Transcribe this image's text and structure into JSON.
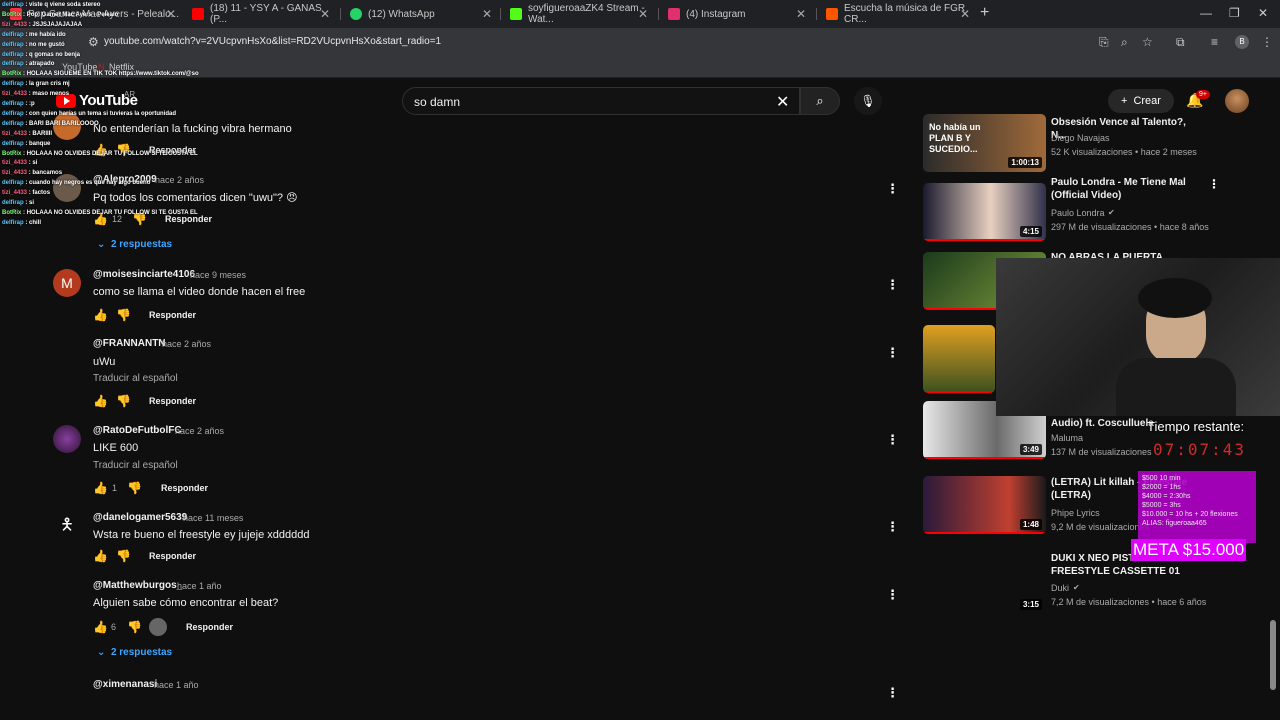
{
  "browser": {
    "tabs": [
      {
        "label": "Pop Gamer Mac Ayers - Pelealo...",
        "color": "#ff3040"
      },
      {
        "label": "(18) 11 - YSY A - GANAS (P...",
        "color": "#ff0000"
      },
      {
        "label": "(12) WhatsApp",
        "color": "#25d366"
      },
      {
        "label": "soyfigueroaaZK4 Stream - Wat...",
        "color": "#53fc18"
      },
      {
        "label": "(4) Instagram",
        "color": "#e1306c"
      },
      {
        "label": "Escucha la música de FGR CR...",
        "color": "#ff5500"
      }
    ],
    "url": "youtube.com/watch?v=2VUcpvnHsXo&list=RD2VUcpvnHsXo&start_radio=1",
    "bookmarks": [
      "YouTube",
      "Netflix"
    ],
    "profile_initial": "B"
  },
  "youtube": {
    "logo": "YouTube",
    "region": "AR",
    "search_value": "so damn",
    "create_label": "Crear",
    "notif_badge": "9+"
  },
  "comments": [
    {
      "text": "No entenderían la fucking vibra hermano",
      "reply": "Responder"
    },
    {
      "author": "@Alepro2009",
      "time": "hace 2 años",
      "text": "Pq todos los comentarios dicen \"uwu\"? 😠",
      "likes": "12",
      "reply": "Responder",
      "replies": "2 respuestas"
    },
    {
      "author": "@moisesinciarte4106",
      "time": "hace 9 meses",
      "text": "como se llama el video donde hacen el free",
      "reply": "Responder",
      "avatar": "M"
    },
    {
      "author": "@FRANNANTN",
      "time": "hace 2 años",
      "text": "uWu",
      "translate": "Traducir al español",
      "reply": "Responder"
    },
    {
      "author": "@RatoDeFutbolFC",
      "time": "hace 2 años",
      "text": "LIKE 600",
      "translate": "Traducir al español",
      "likes": "1",
      "reply": "Responder"
    },
    {
      "author": "@danelogamer5639",
      "time": "hace 11 meses",
      "text": "Wsta re bueno el freestyle ey jujeje xdddddd",
      "reply": "Responder"
    },
    {
      "author": "@Matthewburgos_",
      "time": "hace 1 año",
      "text": "Alguien sabe cómo encontrar el beat?",
      "likes": "6",
      "reply": "Responder",
      "replies": "2 respuestas"
    },
    {
      "author": "@ximenanasi",
      "time": "hace 1 año"
    }
  ],
  "videos": [
    {
      "title": "Obsesión Vence al Talento?, N...",
      "channel": "Diego Navajas",
      "meta": "52 K visualizaciones • hace 2 meses",
      "duration": "1:00:13",
      "thumb_text": "No había un PLAN B Y SUCEDIO..."
    },
    {
      "title": "Paulo Londra - Me Tiene Mal (Official Video)",
      "channel": "Paulo Londra",
      "meta": "297 M de visualizaciones • hace 8 años",
      "duration": "4:15"
    },
    {
      "title": "NO ABRAS LA PUERTA",
      "duration": ""
    },
    {
      "title": "",
      "duration": ""
    },
    {
      "title": "Audio) ft. Cosculluela",
      "channel": "Maluma",
      "meta": "137 M de visualizaciones",
      "duration": "3:49"
    },
    {
      "title": "(LETRA) Lit killah - Freestyle (LETRA)",
      "channel": "Phipe Lyrics",
      "meta": "9,2 M de visualizaciones",
      "duration": "1:48"
    },
    {
      "title": "DUKI X NEO PISTEA FREESTYLE CASSETTE 01",
      "channel": "Duki",
      "meta": "7,2 M de visualizaciones • hace 6 años",
      "duration": "3:15"
    }
  ],
  "stream_overlay": {
    "chat": [
      {
        "user": "delfirap",
        "msg": "viste q viene soda stereo"
      },
      {
        "user": "BotRix",
        "msg": "Pop! Gamer Mac Ayers - Pelealo"
      },
      {
        "user": "tizi_4433",
        "msg": "JSJSJAJAJAJAA"
      },
      {
        "user": "delfirap",
        "msg": "me había ido"
      },
      {
        "user": "delfirap",
        "msg": "no me gustó"
      },
      {
        "user": "delfirap",
        "msg": "q gomas no benja"
      },
      {
        "user": "delfirap",
        "msg": "atrapado"
      },
      {
        "user": "BotRix",
        "msg": "HOLAAA SIGUEME EN TIK TOK https://www.tiktok.com/@so"
      },
      {
        "user": "delfirap",
        "msg": "la gran cris mj"
      },
      {
        "user": "tizi_4433",
        "msg": "maso menos"
      },
      {
        "user": "delfirap",
        "msg": ":p"
      },
      {
        "user": "delfirap",
        "msg": "con quien harías un tema si tuvieras la oportunidad"
      },
      {
        "user": "delfirap",
        "msg": "BARI BARI BARILOOOO"
      },
      {
        "user": "tizi_4433",
        "msg": "BARIIII"
      },
      {
        "user": "delfirap",
        "msg": "banque"
      },
      {
        "user": "BotRix",
        "msg": "HOLAAA NO OLVIDES DEJAR TU FOLLOW SI TE GUSTA EL"
      },
      {
        "user": "tizi_4433",
        "msg": "si"
      },
      {
        "user": "tizi_4433",
        "msg": "bancamos"
      },
      {
        "user": "delfirap",
        "msg": "cuando hay negros es que hay algo bueno"
      },
      {
        "user": "tizi_4433",
        "msg": "factos"
      },
      {
        "user": "delfirap",
        "msg": "si"
      },
      {
        "user": "BotRix",
        "msg": "HOLAAA NO OLVIDES DEJAR TU FOLLOW SI TE GUSTA EL"
      },
      {
        "user": "delfirap",
        "msg": "chill"
      }
    ],
    "timer_label": "Tiempo restante:",
    "timer_value": "07:07:43",
    "goals": [
      "$500 10 min",
      "$2000 = 1hs",
      "$4000 = 2:30hs",
      "$5000 = 3hs",
      "$10.000 = 10 hs + 20 flexiones",
      "ALIAS: figueroaa465"
    ],
    "meta": "META $15.000"
  },
  "colors": {
    "accent": "#3ea6ff",
    "brand": "#ff0000",
    "goal_bg": "#e000ff"
  }
}
